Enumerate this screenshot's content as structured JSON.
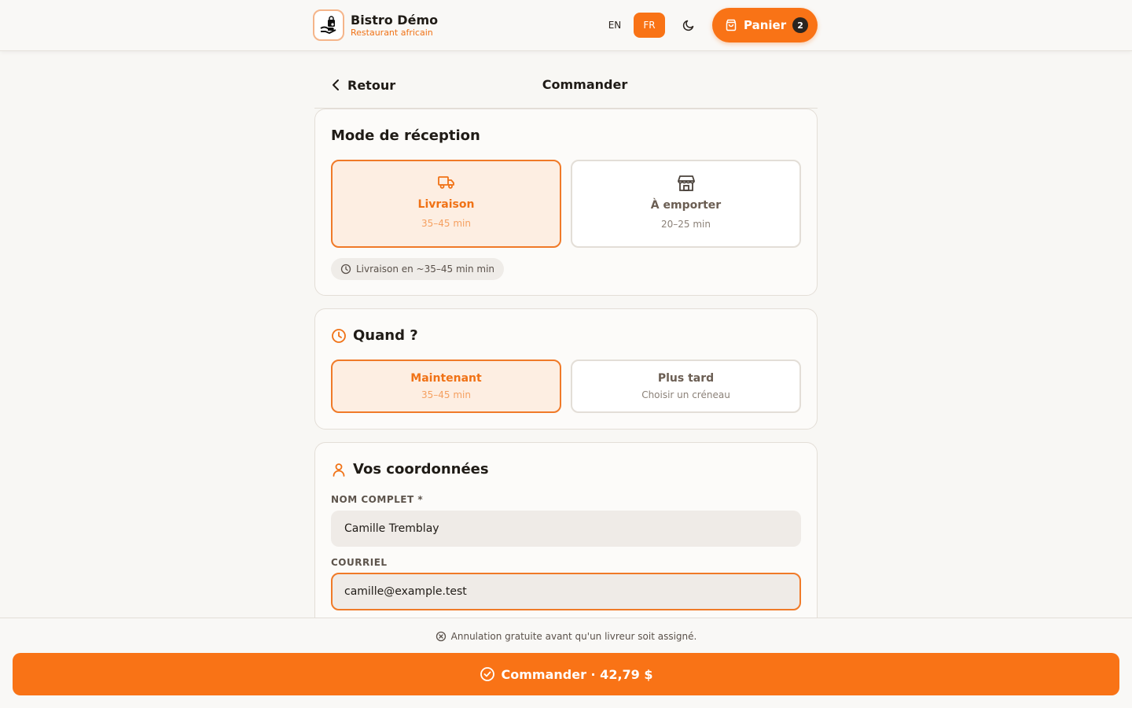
{
  "header": {
    "brand_name": "Bistro Démo",
    "brand_sub": "Restaurant africain",
    "lang_en": "EN",
    "lang_fr": "FR",
    "cart_label": "Panier",
    "cart_count": "2"
  },
  "page": {
    "back_label": "Retour",
    "title": "Commander"
  },
  "reception": {
    "title": "Mode de réception",
    "options": [
      {
        "label": "Livraison",
        "time": "35–45 min",
        "selected": true,
        "icon": "truck-icon"
      },
      {
        "label": "À emporter",
        "time": "20–25 min",
        "selected": false,
        "icon": "store-icon"
      }
    ],
    "eta": "Livraison en ~35–45 min min"
  },
  "when": {
    "title": "Quand ?",
    "options": [
      {
        "label": "Maintenant",
        "sub": "35–45 min",
        "selected": true
      },
      {
        "label": "Plus tard",
        "sub": "Choisir un créneau",
        "selected": false
      }
    ]
  },
  "contact": {
    "title": "Vos coordonnées",
    "name_label": "NOM COMPLET *",
    "name_value": "Camille Tremblay",
    "email_label": "COURRIEL",
    "email_value": "camille@example.test"
  },
  "footer": {
    "notice": "Annulation gratuite avant qu'un livreur soit assigné.",
    "order_label": "Commander · 42,79 $"
  },
  "colors": {
    "accent": "#f97316",
    "accent_light": "#fdeee2",
    "background": "#f8f7f4"
  }
}
